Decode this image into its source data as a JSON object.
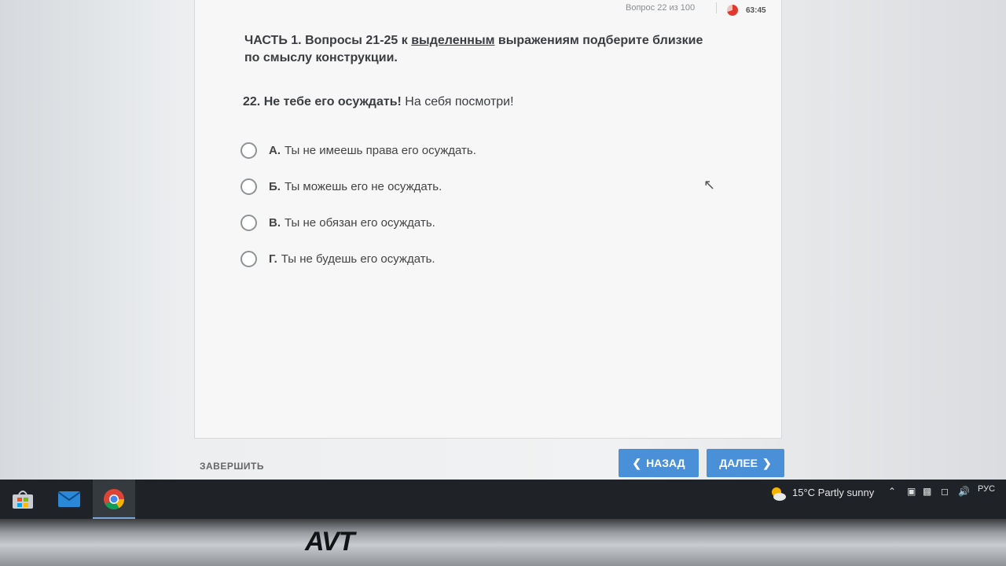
{
  "progress": {
    "counter": "Вопрос 22 из 100",
    "timer": "63:45"
  },
  "instruction": {
    "before": "ЧАСТЬ 1. Вопросы 21-25 к ",
    "underlined": "выделенным",
    "after": " выражениям подберите близкие по смыслу конструкции."
  },
  "question": {
    "bold": "22. Не тебе его осуждать!",
    "rest": " На себя посмотри!"
  },
  "options": [
    {
      "letter": "А.",
      "text": "Ты не имеешь права его осуждать."
    },
    {
      "letter": "Б.",
      "text": "Ты можешь его не осуждать."
    },
    {
      "letter": "В.",
      "text": "Ты не обязан его осуждать."
    },
    {
      "letter": "Г.",
      "text": "Ты не будешь его осуждать."
    }
  ],
  "footer": {
    "finish": "ЗАВЕРШИТЬ",
    "back": "НАЗАД",
    "next": "ДАЛЕЕ"
  },
  "taskbar": {
    "temperature": "15°C",
    "weather": "Partly sunny",
    "language": "РУС"
  },
  "monitor": {
    "brand": "AVT"
  },
  "colors": {
    "accent": "#4a90d9",
    "timer": "#e0392f",
    "taskbar": "#1f2327"
  }
}
